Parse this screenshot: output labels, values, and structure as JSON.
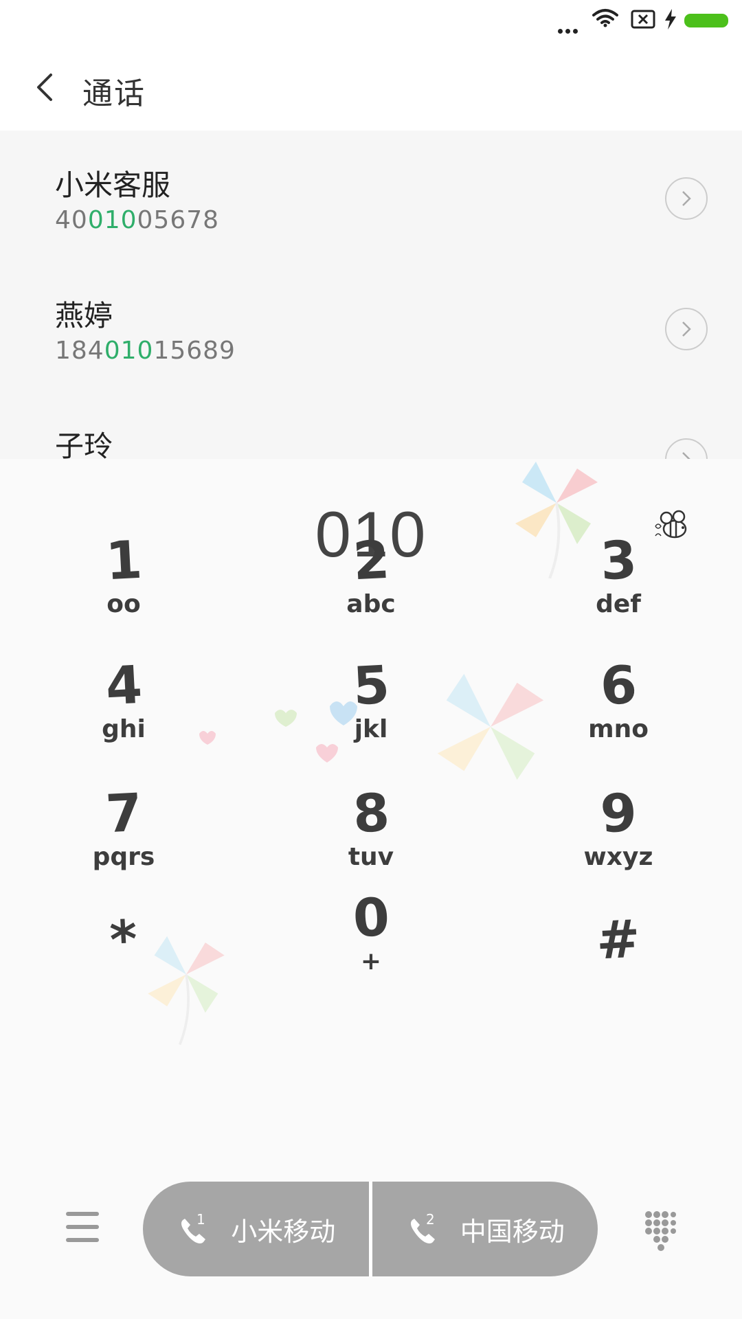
{
  "header": {
    "title": "通话"
  },
  "results": [
    {
      "name": "小米客服",
      "number_pre": "40",
      "number_match": "010",
      "number_post": "05678"
    },
    {
      "name": "燕婷",
      "number_pre": "184",
      "number_match": "010",
      "number_post": "15689"
    },
    {
      "name": "子玲",
      "number_pre": "",
      "number_match": "",
      "number_post": ""
    }
  ],
  "dialer": {
    "input": "010"
  },
  "keys": [
    {
      "digit": "1",
      "letters": "oo"
    },
    {
      "digit": "2",
      "letters": "abc"
    },
    {
      "digit": "3",
      "letters": "def"
    },
    {
      "digit": "4",
      "letters": "ghi"
    },
    {
      "digit": "5",
      "letters": "jkl"
    },
    {
      "digit": "6",
      "letters": "mno"
    },
    {
      "digit": "7",
      "letters": "pqrs"
    },
    {
      "digit": "8",
      "letters": "tuv"
    },
    {
      "digit": "9",
      "letters": "wxyz"
    },
    {
      "digit": "*",
      "letters": ""
    },
    {
      "digit": "0",
      "letters": "+"
    },
    {
      "digit": "#",
      "letters": ""
    }
  ],
  "call_buttons": [
    {
      "sim_number": "1",
      "label": "小米移动"
    },
    {
      "sim_number": "2",
      "label": "中国移动"
    }
  ],
  "colors": {
    "match_highlight": "#2fae6a",
    "battery": "#4cc01b",
    "call_button": "#a6a6a6"
  },
  "icons": [
    "wifi-icon",
    "no-sim-icon",
    "charging-icon",
    "battery-icon",
    "back-arrow-icon",
    "chevron-right-icon",
    "bee-icon",
    "menu-icon",
    "phone-sim-icon",
    "keypad-icon"
  ]
}
